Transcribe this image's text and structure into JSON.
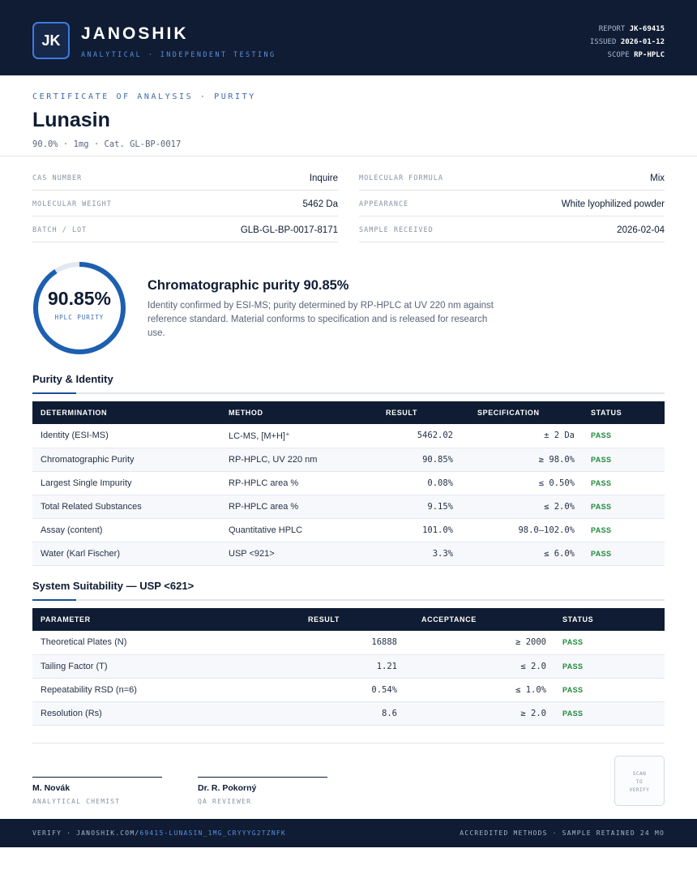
{
  "header": {
    "logo_text": "JK",
    "brand": "JANOSHIK",
    "tagline": "ANALYTICAL · INDEPENDENT TESTING",
    "report_label": "REPORT",
    "report_value": "JK-69415",
    "issued_label": "ISSUED",
    "issued_value": "2026-01-12",
    "scope_label": "SCOPE",
    "scope_value": "RP-HPLC"
  },
  "doc": {
    "kicker": "CERTIFICATE OF ANALYSIS · PURITY",
    "title": "Lunasin",
    "subtitle": "90.0% · 1mg  ·  Cat. GL-BP-0017"
  },
  "info": {
    "left": [
      {
        "label": "CAS NUMBER",
        "value": "Inquire"
      },
      {
        "label": "MOLECULAR WEIGHT",
        "value": "5462 Da"
      },
      {
        "label": "BATCH / LOT",
        "value": "GLB-GL-BP-0017-8171"
      }
    ],
    "right": [
      {
        "label": "MOLECULAR FORMULA",
        "value": "Mix"
      },
      {
        "label": "APPEARANCE",
        "value": "White lyophilized powder"
      },
      {
        "label": "SAMPLE RECEIVED",
        "value": "2026-02-04"
      }
    ]
  },
  "purity": {
    "value_text": "90.85%",
    "fraction": 0.9085,
    "gauge_label": "HPLC PURITY",
    "headline": "Chromatographic purity 90.85%",
    "description": "Identity confirmed by ESI-MS; purity determined by RP-HPLC at UV 220 nm against reference standard. Material conforms to specification and is released for research use."
  },
  "purity_identity": {
    "title": "Purity & Identity",
    "headers": [
      "DETERMINATION",
      "METHOD",
      "RESULT",
      "SPECIFICATION",
      "STATUS"
    ],
    "rows": [
      [
        "Identity (ESI-MS)",
        "LC-MS, [M+H]⁺",
        "5462.02",
        "± 2 Da",
        "PASS"
      ],
      [
        "Chromatographic Purity",
        "RP-HPLC, UV 220 nm",
        "90.85%",
        "≥ 98.0%",
        "PASS"
      ],
      [
        "Largest Single Impurity",
        "RP-HPLC area %",
        "0.08%",
        "≤ 0.50%",
        "PASS"
      ],
      [
        "Total Related Substances",
        "RP-HPLC area %",
        "9.15%",
        "≤ 2.0%",
        "PASS"
      ],
      [
        "Assay (content)",
        "Quantitative HPLC",
        "101.0%",
        "98.0–102.0%",
        "PASS"
      ],
      [
        "Water (Karl Fischer)",
        "USP <921>",
        "3.3%",
        "≤ 6.0%",
        "PASS"
      ]
    ]
  },
  "system_suitability": {
    "title": "System Suitability — USP <621>",
    "headers": [
      "PARAMETER",
      "RESULT",
      "ACCEPTANCE",
      "STATUS"
    ],
    "rows": [
      [
        "Theoretical Plates (N)",
        "16888",
        "≥ 2000",
        "PASS"
      ],
      [
        "Tailing Factor (T)",
        "1.21",
        "≤ 2.0",
        "PASS"
      ],
      [
        "Repeatability RSD (n=6)",
        "0.54%",
        "≤ 1.0%",
        "PASS"
      ],
      [
        "Resolution (Rs)",
        "8.6",
        "≥ 2.0",
        "PASS"
      ]
    ]
  },
  "signatures": [
    {
      "name": "M. Novák",
      "role": "ANALYTICAL CHEMIST"
    },
    {
      "name": "Dr. R. Pokorný",
      "role": "QA REVIEWER"
    }
  ],
  "qr": {
    "line1": "SCAN",
    "line2": "TO",
    "line3": "VERIFY"
  },
  "footer": {
    "verify_prefix": "VERIFY · JANOSHIK.COM/",
    "verify_link": "69415-LUNASIN_1MG_CRYYYG2TZNFK",
    "right": "ACCREDITED METHODS · SAMPLE RETAINED 24 MO"
  },
  "colors": {
    "navy": "#0f1c33",
    "accent": "#1d5fb0",
    "pass": "#1f8a3c"
  }
}
